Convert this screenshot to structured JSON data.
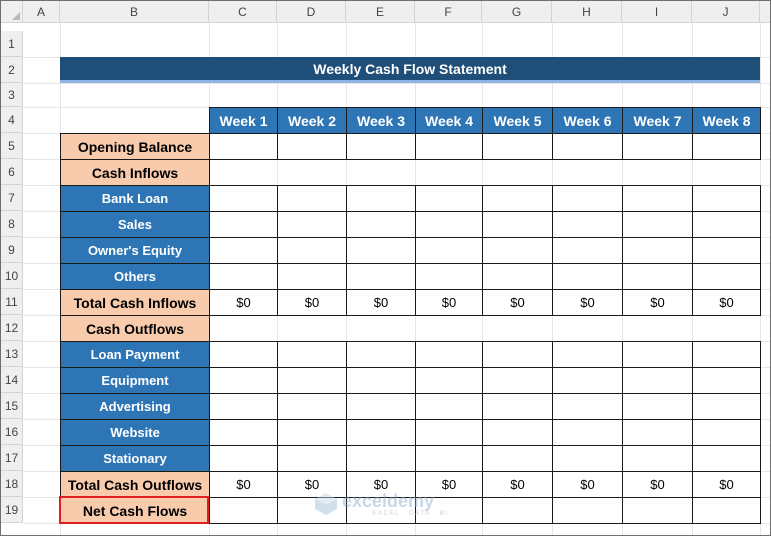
{
  "columns": [
    "A",
    "B",
    "C",
    "D",
    "E",
    "F",
    "G",
    "H",
    "I",
    "J"
  ],
  "rows": [
    "1",
    "2",
    "3",
    "4",
    "5",
    "6",
    "7",
    "8",
    "9",
    "10",
    "11",
    "12",
    "13",
    "14",
    "15",
    "16",
    "17",
    "18",
    "19"
  ],
  "title": "Weekly Cash Flow Statement",
  "weeks": [
    "Week 1",
    "Week 2",
    "Week 3",
    "Week 4",
    "Week 5",
    "Week 6",
    "Week 7",
    "Week 8"
  ],
  "labels": {
    "opening_balance": "Opening Balance",
    "cash_inflows": "Cash Inflows",
    "bank_loan": "Bank Loan",
    "sales": "Sales",
    "owners_equity": "Owner's Equity",
    "others": "Others",
    "total_cash_inflows": "Total Cash Inflows",
    "cash_outflows": "Cash Outflows",
    "loan_payment": "Loan Payment",
    "equipment": "Equipment",
    "advertising": "Advertising",
    "website": "Website",
    "stationary": "Stationary",
    "total_cash_outflows": "Total Cash Outflows",
    "net_cash_flows": "Net Cash Flows"
  },
  "total_inflows": [
    "$0",
    "$0",
    "$0",
    "$0",
    "$0",
    "$0",
    "$0",
    "$0"
  ],
  "total_outflows": [
    "$0",
    "$0",
    "$0",
    "$0",
    "$0",
    "$0",
    "$0",
    "$0"
  ],
  "watermark": {
    "name": "exceldemy",
    "tagline": "EXCEL · DATA · BI"
  },
  "colors": {
    "title_bg": "#1f4e79",
    "header_blue": "#2e75b6",
    "label_peach": "#f8cbad",
    "highlight_red": "#e02020"
  }
}
